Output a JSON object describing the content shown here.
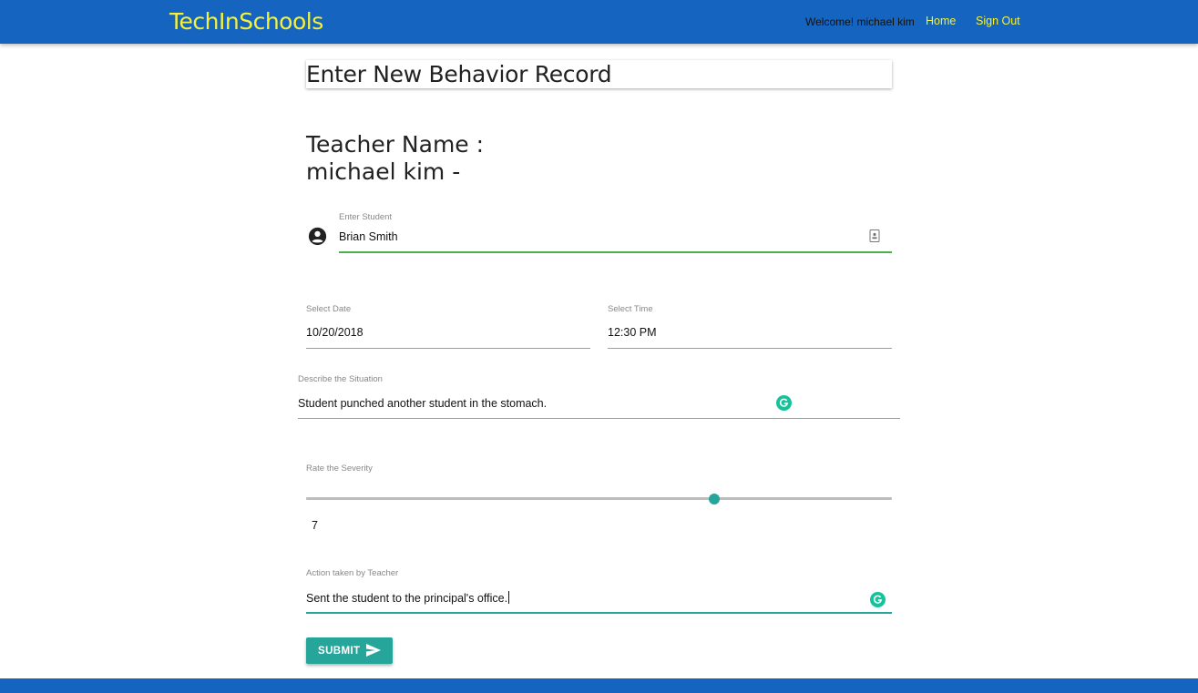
{
  "navbar": {
    "brand": "TechInSchools",
    "welcome": "Welcome! michael kim",
    "home_label": "Home",
    "signout_label": "Sign Out",
    "background_color": "#1565c0",
    "link_color": "#f4f13d"
  },
  "page": {
    "title": "Enter New Behavior Record",
    "teacher_line": "Teacher Name : michael kim -"
  },
  "form": {
    "student": {
      "label": "Enter Student",
      "value": "Brian Smith",
      "icon": "account-circle-icon",
      "trailing_icon": "contact-card-icon"
    },
    "date": {
      "label": "Select Date",
      "value": "10/20/2018"
    },
    "time": {
      "label": "Select Time",
      "value": "12:30 PM"
    },
    "situation": {
      "label": "Describe the Situation",
      "value": "Student punched another student in the stomach."
    },
    "severity": {
      "label": "Rate the Severity",
      "value": 7,
      "value_text": "7",
      "fraction": 0.696
    },
    "action": {
      "label": "Action taken by Teacher",
      "value": "Sent the student to the principal's office."
    },
    "submit_label": "SUBMIT",
    "accent_color": "#26a69a",
    "grammarly_color": "#15c39a"
  },
  "footer": {
    "background_color": "#1565c0"
  }
}
